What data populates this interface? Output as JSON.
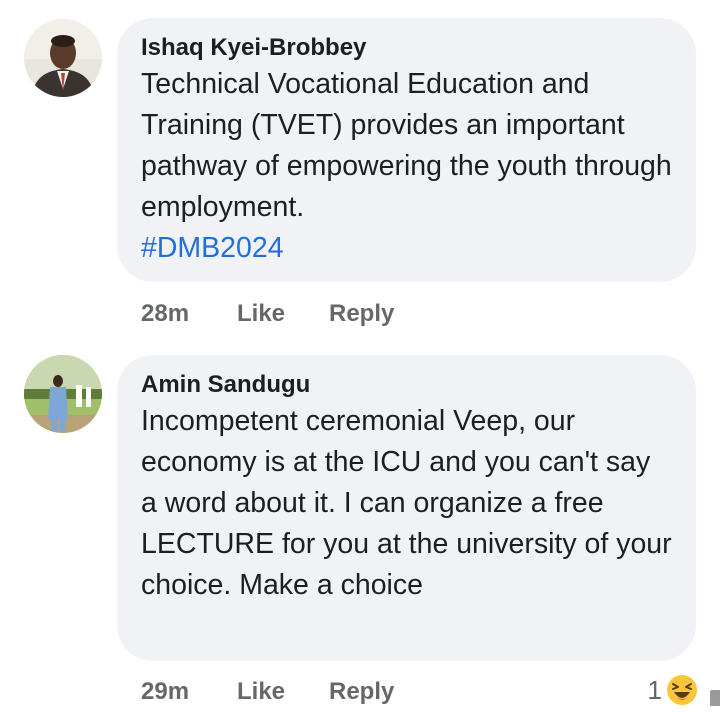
{
  "comments": [
    {
      "author": "Ishaq Kyei-Brobbey",
      "text": "Technical Vocational Education and Training (TVET) provides an important pathway of empowering the youth through employment.",
      "hashtag": "#DMB2024",
      "time": "28m",
      "like_label": "Like",
      "reply_label": "Reply"
    },
    {
      "author": "Amin Sandugu",
      "text": "Incompetent ceremonial Veep, our economy is at the ICU and you can't say a word about it. I can organize a free LECTURE for you at the university of your choice. Make a choice",
      "time": "29m",
      "like_label": "Like",
      "reply_label": "Reply",
      "reaction_count": "1",
      "reaction_icon": "laughing-emoji-icon"
    }
  ],
  "colors": {
    "bubble": "#f0f2f5",
    "text": "#1c1e21",
    "muted": "#65676b",
    "hashtag": "#216fdb"
  }
}
